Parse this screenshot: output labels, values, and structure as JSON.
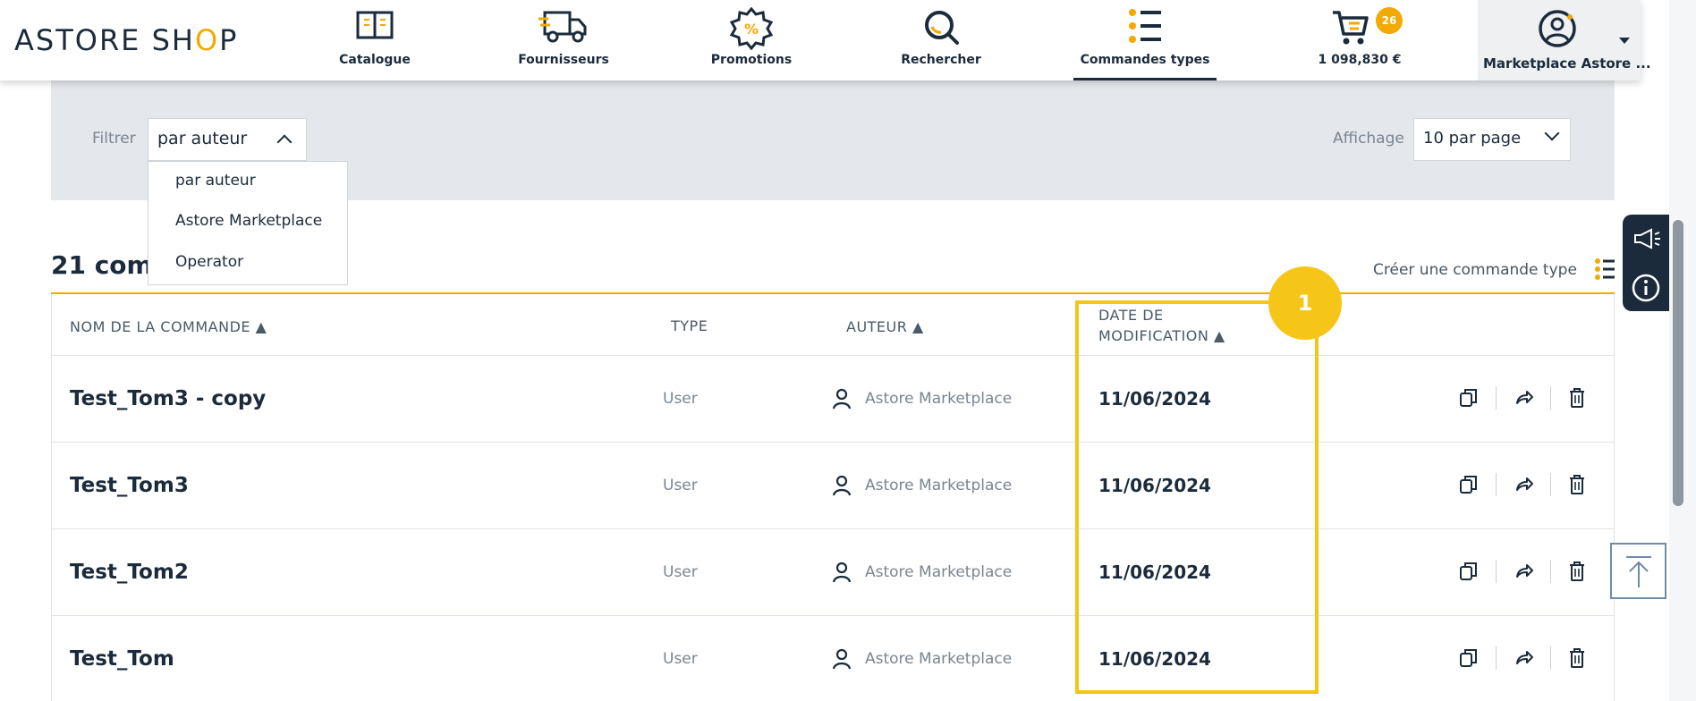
{
  "header": {
    "logo_prefix": "ASTORE SH",
    "logo_o": "O",
    "logo_suffix": "P",
    "nav": [
      {
        "label": "Catalogue",
        "icon": "book-icon"
      },
      {
        "label": "Fournisseurs",
        "icon": "truck-icon"
      },
      {
        "label": "Promotions",
        "icon": "percent-badge-icon"
      },
      {
        "label": "Rechercher",
        "icon": "search-icon"
      },
      {
        "label": "Commandes types",
        "icon": "list-icon",
        "active": true
      }
    ],
    "cart": {
      "amount": "1 098,830 €",
      "count": "26",
      "icon": "cart-icon"
    },
    "account": {
      "label": "Marketplace Astore ...",
      "icon": "user-circle-icon"
    }
  },
  "filters": {
    "filter_label": "Filtrer",
    "filter_value": "par auteur",
    "filter_options": [
      "par auteur",
      "Astore Marketplace",
      "Operator"
    ],
    "display_label": "Affichage",
    "display_value": "10 par page"
  },
  "list": {
    "count_title": "21 comm",
    "create_label": "Créer une commande type",
    "columns": {
      "name": "NOM DE LA COMMANDE ▲",
      "type": "TYPE",
      "author": "AUTEUR ▲",
      "date_line1": "DATE DE",
      "date_line2": "MODIFICATION ▲"
    },
    "rows": [
      {
        "name": "Test_Tom3 - copy",
        "type": "User",
        "author": "Astore Marketplace",
        "date": "11/06/2024"
      },
      {
        "name": "Test_Tom3",
        "type": "User",
        "author": "Astore Marketplace",
        "date": "11/06/2024"
      },
      {
        "name": "Test_Tom2",
        "type": "User",
        "author": "Astore Marketplace",
        "date": "11/06/2024"
      },
      {
        "name": "Test_Tom",
        "type": "User",
        "author": "Astore Marketplace",
        "date": "11/06/2024"
      }
    ]
  },
  "annotation": {
    "step": "1"
  },
  "colors": {
    "brand": "#1b2b3c",
    "accent": "#f2a900",
    "highlight": "#f5c518"
  }
}
